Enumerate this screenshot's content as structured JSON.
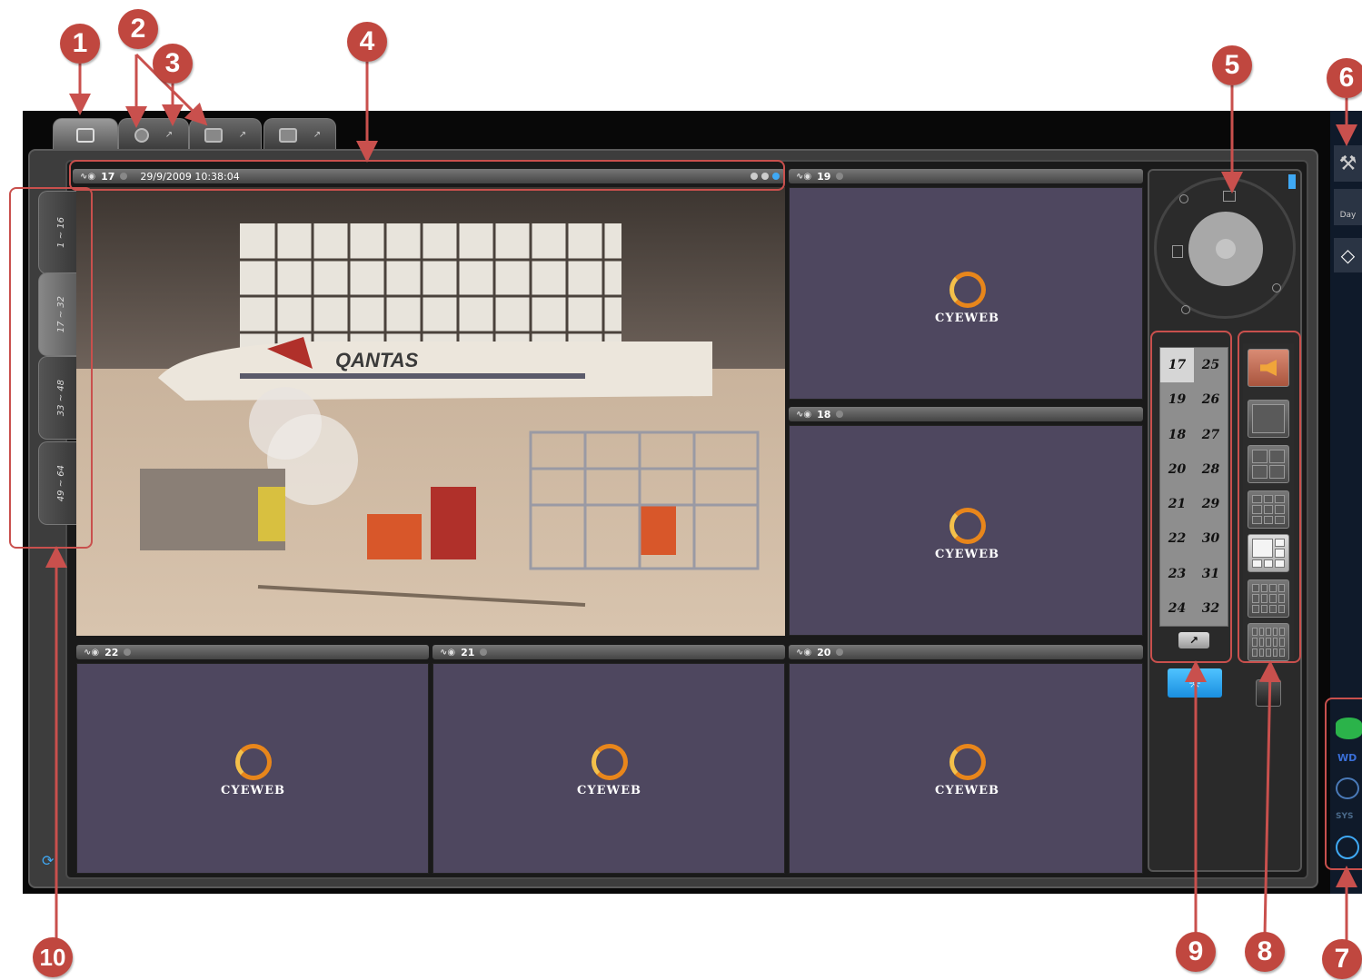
{
  "top_tabs": [
    {
      "name": "live-view",
      "active": true
    },
    {
      "name": "playback",
      "active": false
    },
    {
      "name": "remote-playback",
      "active": false
    },
    {
      "name": "config",
      "active": false
    }
  ],
  "main_camera": {
    "channel": "17",
    "timestamp": "29/9/2009 10:38:04"
  },
  "scene_text": "QANTAS",
  "cells": [
    {
      "channel": "19",
      "logo": "CYEWEB"
    },
    {
      "channel": "18",
      "logo": "CYEWEB"
    },
    {
      "channel": "22",
      "logo": "CYEWEB"
    },
    {
      "channel": "21",
      "logo": "CYEWEB"
    },
    {
      "channel": "20",
      "logo": "CYEWEB"
    }
  ],
  "side_tabs": [
    {
      "label": "1 ~ 16",
      "active": false
    },
    {
      "label": "17 ~ 32",
      "active": true
    },
    {
      "label": "33 ~ 48",
      "active": false
    },
    {
      "label": "49 ~ 64",
      "active": false
    }
  ],
  "channel_buttons": [
    {
      "label": "17",
      "selected": true
    },
    {
      "label": "25",
      "selected": false
    },
    {
      "label": "19",
      "selected": false
    },
    {
      "label": "26",
      "selected": false
    },
    {
      "label": "18",
      "selected": false
    },
    {
      "label": "27",
      "selected": false
    },
    {
      "label": "20",
      "selected": false
    },
    {
      "label": "28",
      "selected": false
    },
    {
      "label": "21",
      "selected": false
    },
    {
      "label": "29",
      "selected": false
    },
    {
      "label": "22",
      "selected": false
    },
    {
      "label": "30",
      "selected": false
    },
    {
      "label": "23",
      "selected": false
    },
    {
      "label": "31",
      "selected": false
    },
    {
      "label": "24",
      "selected": false
    },
    {
      "label": "32",
      "selected": false
    }
  ],
  "tool_strip": {
    "day_label": "Day",
    "disk_label": "WD",
    "sys_label": "SYS"
  },
  "badges": [
    "1",
    "2",
    "3",
    "4",
    "5",
    "6",
    "7",
    "8",
    "9",
    "10"
  ],
  "colors": {
    "annotation": "#c9504d",
    "badge": "#c0473f",
    "cell_bg": "#4e475f",
    "logo_orange": "#e8861b"
  }
}
